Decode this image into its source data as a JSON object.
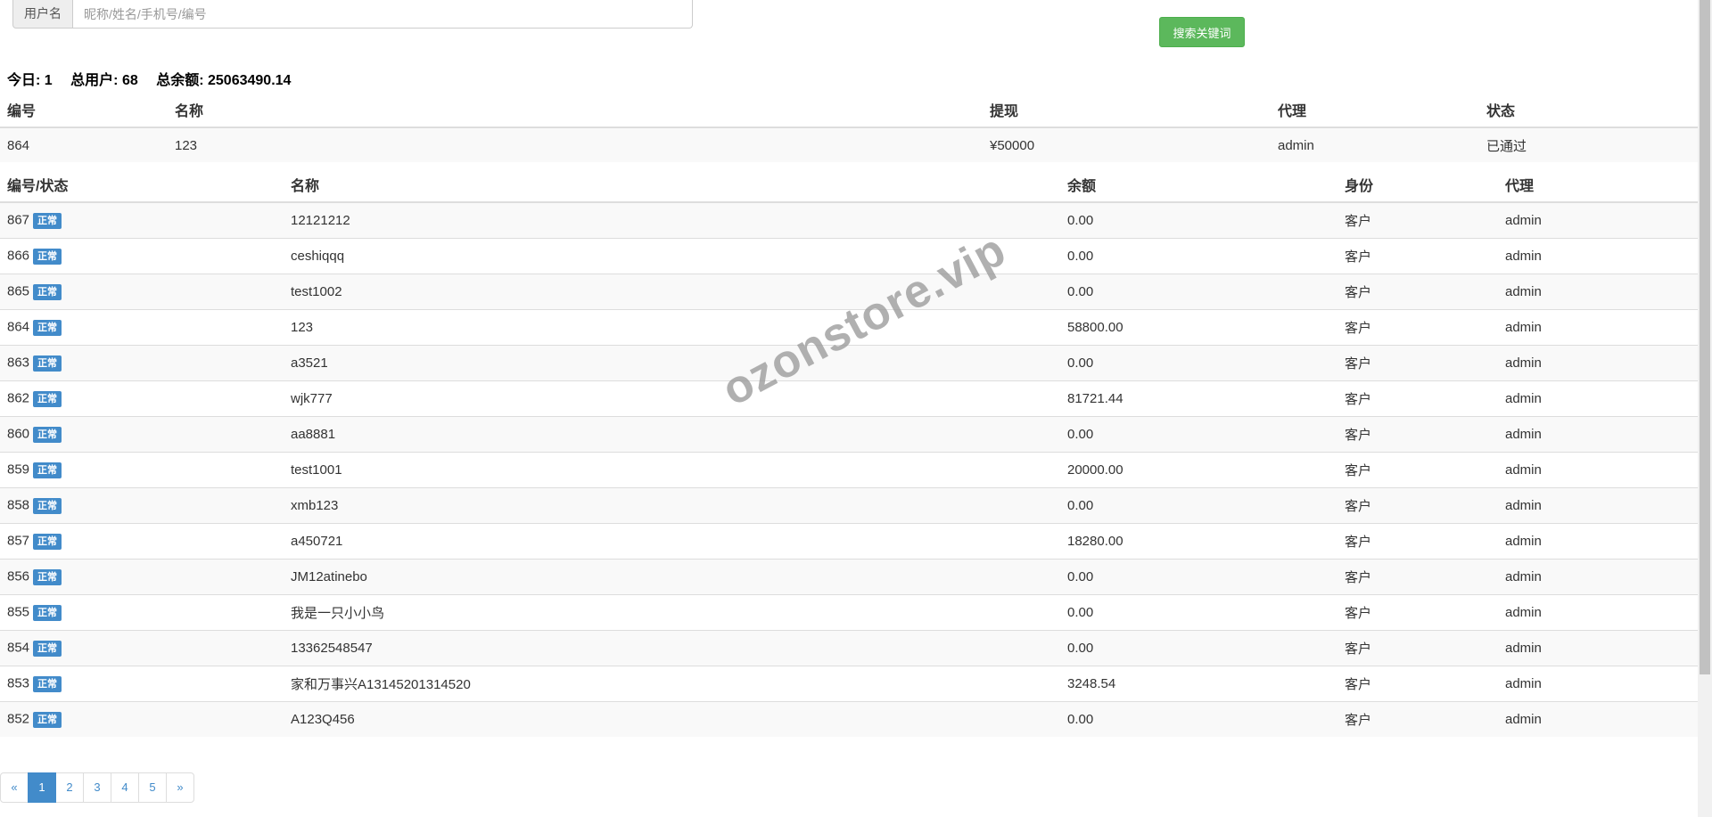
{
  "search": {
    "label": "用户名",
    "placeholder": "昵称/姓名/手机号/编号",
    "button": "搜索关键词"
  },
  "summary": {
    "today_label": "今日:",
    "today_value": "1",
    "total_users_label": "总用户:",
    "total_users_value": "68",
    "total_balance_label": "总余额:",
    "total_balance_value": "25063490.14"
  },
  "withdraw_table": {
    "headers": [
      "编号",
      "名称",
      "提现",
      "代理",
      "状态"
    ],
    "rows": [
      {
        "id": "864",
        "name": "123",
        "amount": "¥50000",
        "agent": "admin",
        "status": "已通过"
      }
    ]
  },
  "user_table": {
    "headers": [
      "编号/状态",
      "名称",
      "余额",
      "身份",
      "代理"
    ],
    "rows": [
      {
        "id": "867",
        "status": "正常",
        "name": "12121212",
        "balance": "0.00",
        "role": "客户",
        "agent": "admin"
      },
      {
        "id": "866",
        "status": "正常",
        "name": "ceshiqqq",
        "balance": "0.00",
        "role": "客户",
        "agent": "admin"
      },
      {
        "id": "865",
        "status": "正常",
        "name": "test1002",
        "balance": "0.00",
        "role": "客户",
        "agent": "admin"
      },
      {
        "id": "864",
        "status": "正常",
        "name": "123",
        "balance": "58800.00",
        "role": "客户",
        "agent": "admin"
      },
      {
        "id": "863",
        "status": "正常",
        "name": "a3521",
        "balance": "0.00",
        "role": "客户",
        "agent": "admin"
      },
      {
        "id": "862",
        "status": "正常",
        "name": "wjk777",
        "balance": "81721.44",
        "role": "客户",
        "agent": "admin"
      },
      {
        "id": "860",
        "status": "正常",
        "name": "aa8881",
        "balance": "0.00",
        "role": "客户",
        "agent": "admin"
      },
      {
        "id": "859",
        "status": "正常",
        "name": "test1001",
        "balance": "20000.00",
        "role": "客户",
        "agent": "admin"
      },
      {
        "id": "858",
        "status": "正常",
        "name": "xmb123",
        "balance": "0.00",
        "role": "客户",
        "agent": "admin"
      },
      {
        "id": "857",
        "status": "正常",
        "name": "a450721",
        "balance": "18280.00",
        "role": "客户",
        "agent": "admin"
      },
      {
        "id": "856",
        "status": "正常",
        "name": "JM12atinebo",
        "balance": "0.00",
        "role": "客户",
        "agent": "admin"
      },
      {
        "id": "855",
        "status": "正常",
        "name": "我是一只小小鸟",
        "balance": "0.00",
        "role": "客户",
        "agent": "admin"
      },
      {
        "id": "854",
        "status": "正常",
        "name": "13362548547",
        "balance": "0.00",
        "role": "客户",
        "agent": "admin"
      },
      {
        "id": "853",
        "status": "正常",
        "name": "家和万事兴A13145201314520",
        "balance": "3248.54",
        "role": "客户",
        "agent": "admin"
      },
      {
        "id": "852",
        "status": "正常",
        "name": "A123Q456",
        "balance": "0.00",
        "role": "客户",
        "agent": "admin"
      }
    ]
  },
  "pagination": {
    "prev": "«",
    "pages": [
      "1",
      "2",
      "3",
      "4",
      "5"
    ],
    "active": "1",
    "next": "»"
  },
  "watermark": "ozonstore.vip",
  "colors": {
    "search_button": "#5cb85c",
    "status_badge": "#428bca",
    "active_page": "#428bca",
    "stripe": "#f9f9f9"
  }
}
